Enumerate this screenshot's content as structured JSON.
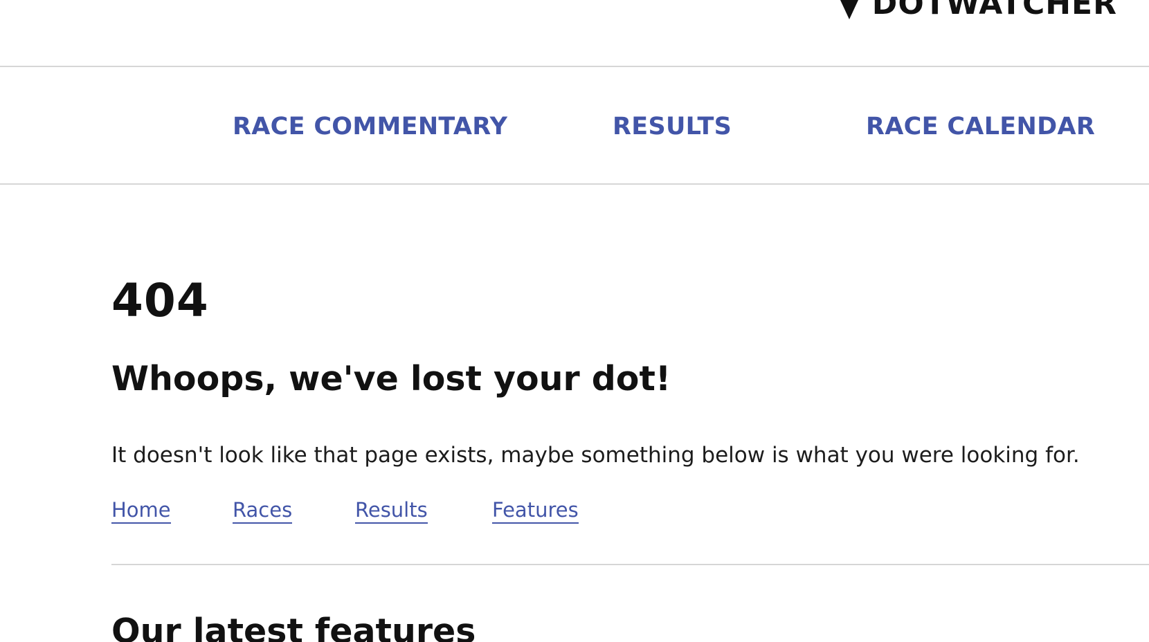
{
  "header": {
    "brand_name": "DOTWATCHER",
    "brand_icon": "map-pin-icon"
  },
  "nav": {
    "items": [
      {
        "label": "RACE COMMENTARY"
      },
      {
        "label": "RESULTS"
      },
      {
        "label": "RACE CALENDAR"
      }
    ]
  },
  "error": {
    "code": "404",
    "headline": "Whoops, we've lost your dot!",
    "message": "It doesn't look like that page exists, maybe something below is what you were looking for."
  },
  "quick_links": [
    {
      "label": "Home"
    },
    {
      "label": "Races"
    },
    {
      "label": "Results"
    },
    {
      "label": "Features"
    }
  ],
  "features_section": {
    "title": "Our latest features"
  },
  "colors": {
    "link": "#4255a8",
    "text": "#111111",
    "divider": "#d6d6d6"
  }
}
